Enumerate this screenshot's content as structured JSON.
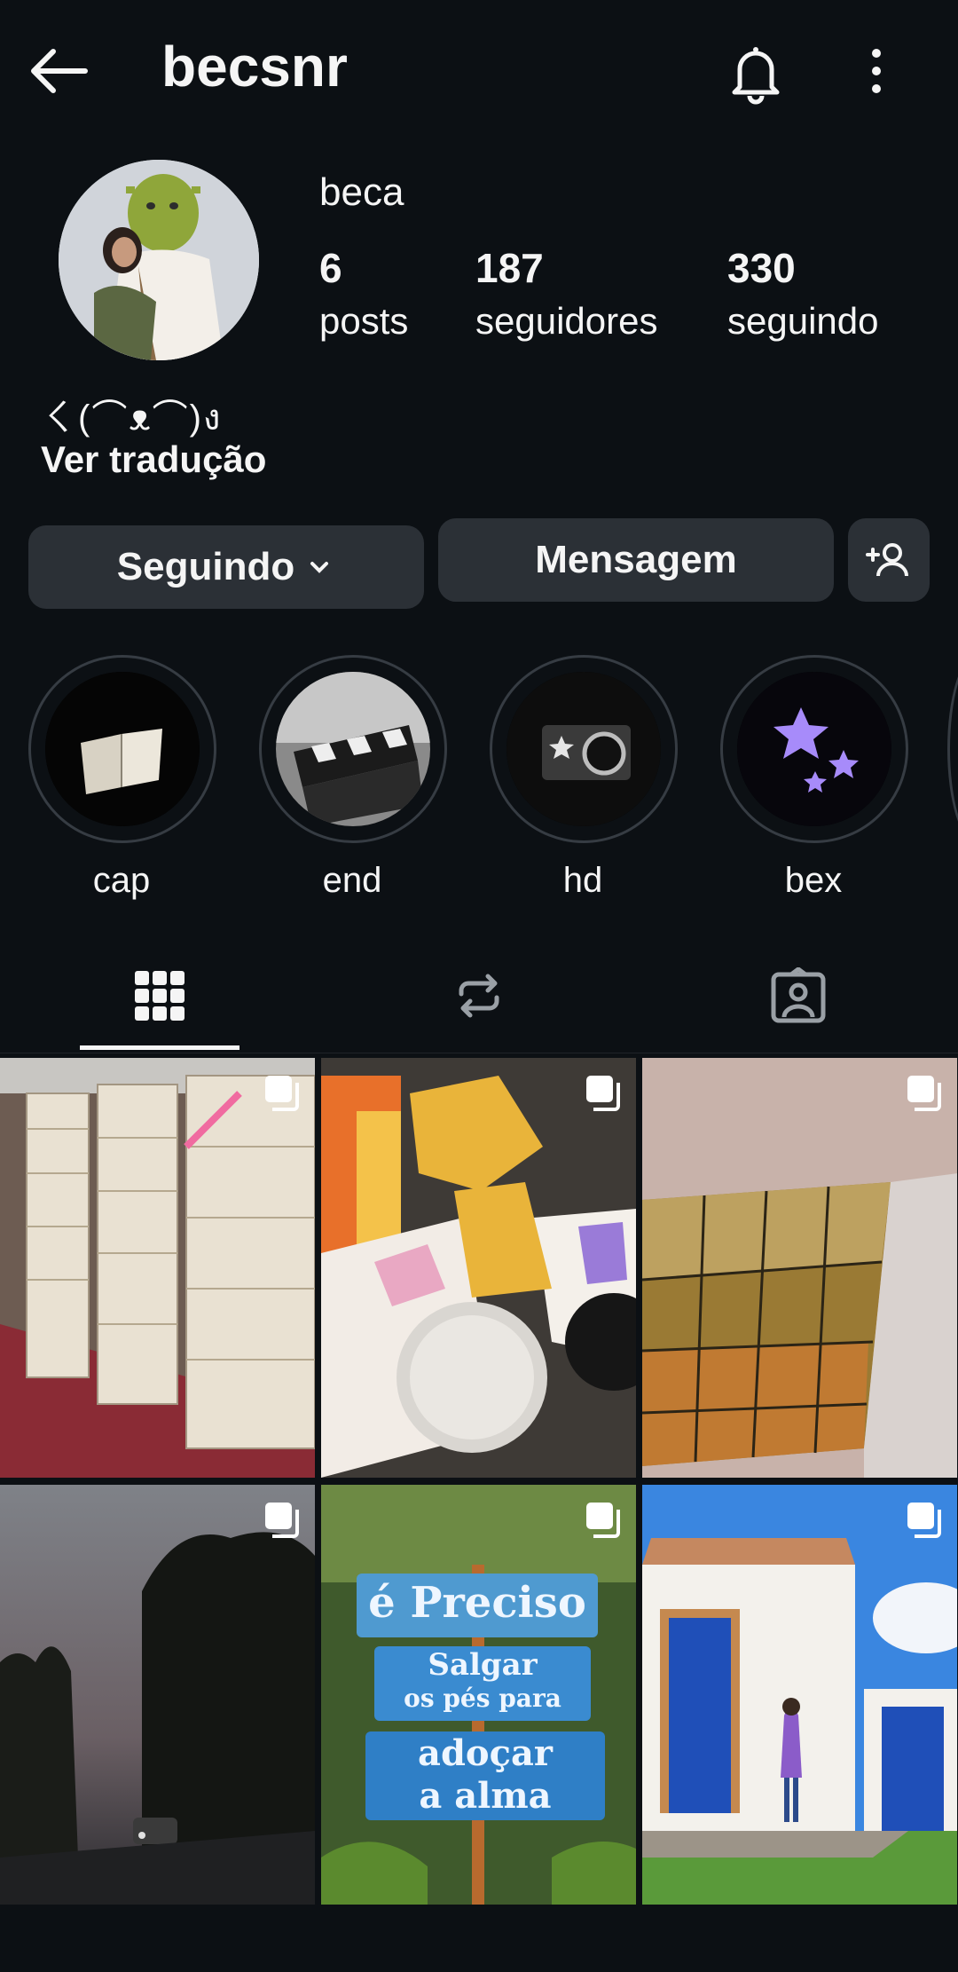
{
  "header": {
    "username": "becsnr"
  },
  "profile": {
    "display_name": "beca",
    "stats": [
      {
        "value": "6",
        "label": "posts"
      },
      {
        "value": "187",
        "label": "seguidores"
      },
      {
        "value": "330",
        "label": "seguindo"
      }
    ],
    "bio": "ㄑ(⌒ᴥ⌒)ง",
    "translate_link": "Ver tradução"
  },
  "actions": {
    "following": "Seguindo",
    "message": "Mensagem"
  },
  "highlights": [
    {
      "label": "cap"
    },
    {
      "label": "end"
    },
    {
      "label": "hd"
    },
    {
      "label": "bex"
    }
  ],
  "sign_text": {
    "line1": "é Preciso",
    "line2": "Salgar",
    "line3": "os pés para",
    "line4": "adoçar",
    "line5": "a alma"
  },
  "colors": {
    "background": "#0c1014",
    "button": "#2b3036",
    "text": "#f5f5f5",
    "accent_star": "#a78bfa"
  }
}
